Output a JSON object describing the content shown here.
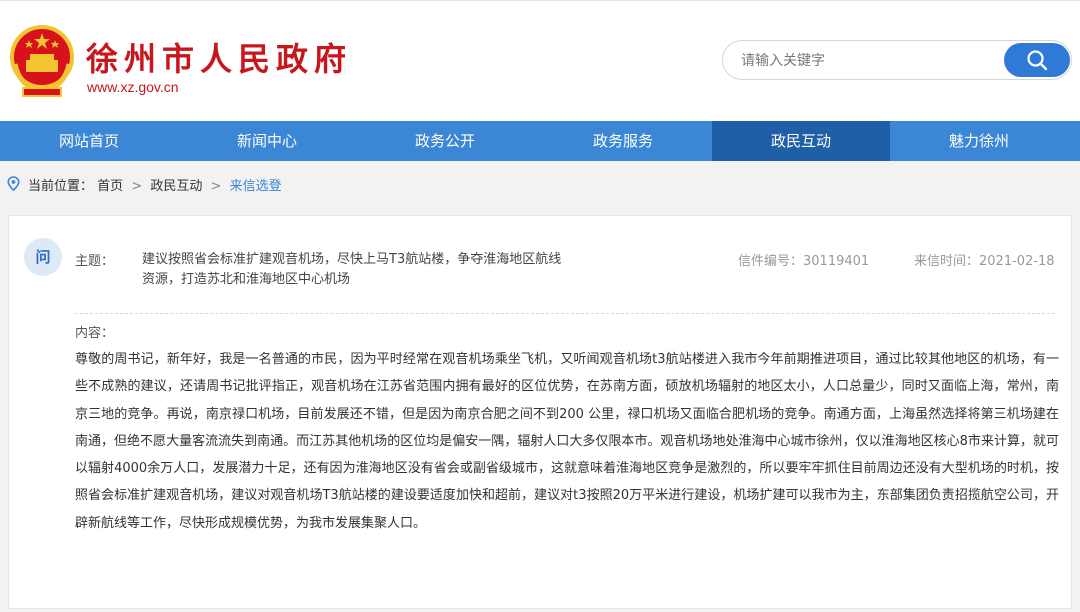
{
  "header": {
    "site_title": "徐州市人民政府",
    "site_url": "www.xz.gov.cn",
    "emblem_icon": "national-emblem-icon",
    "search_placeholder": "请输入关键字",
    "search_icon": "search-icon"
  },
  "nav": {
    "items": [
      {
        "label": "网站首页"
      },
      {
        "label": "新闻中心"
      },
      {
        "label": "政务公开"
      },
      {
        "label": "政务服务"
      },
      {
        "label": "政民互动",
        "active": true
      },
      {
        "label": "魅力徐州"
      }
    ]
  },
  "breadcrumb": {
    "prefix": "当前位置：",
    "items": [
      "首页",
      "政民互动",
      "来信选登"
    ],
    "separator": ">"
  },
  "letter": {
    "badge": "问",
    "subject_label": "主题：",
    "subject": "建议按照省会标准扩建观音机场，尽快上马T3航站楼，争夺淮海地区航线资源，打造苏北和淮海地区中心机场",
    "number_label": "信件编号：30119401",
    "date_label": "来信时间：2021-02-18",
    "content_label": "内容：",
    "content": "尊敬的周书记，新年好，我是一名普通的市民，因为平时经常在观音机场乘坐飞机，又听闻观音机场t3航站楼进入我市今年前期推进项目，通过比较其他地区的机场，有一些不成熟的建议，还请周书记批评指正，观音机场在江苏省范围内拥有最好的区位优势，在苏南方面，硕放机场辐射的地区太小，人口总量少，同时又面临上海，常州，南京三地的竞争。再说，南京禄口机场，目前发展还不错，但是因为南京合肥之间不到200 公里，禄口机场又面临合肥机场的竞争。南通方面，上海虽然选择将第三机场建在南通，但绝不愿大量客流流失到南通。而江苏其他机场的区位均是偏安一隅，辐射人口大多仅限本市。观音机场地处淮海中心城市徐州，仅以淮海地区核心8市来计算，就可以辐射4000余万人口，发展潜力十足，还有因为淮海地区没有省会或副省级城市，这就意味着淮海地区竞争是激烈的，所以要牢牢抓住目前周边还没有大型机场的时机，按照省会标准扩建观音机场，建议对观音机场T3航站楼的建设要适度加快和超前，建议对t3按照20万平米进行建设，机场扩建可以我市为主，东部集团负责招揽航空公司，开辟新航线等工作，尽快形成规模优势，为我市发展集聚人口。"
  },
  "colors": {
    "brand_red": "#c8161d",
    "nav_blue": "#3b86d5",
    "nav_active": "#1f5fa8",
    "accent_blue": "#2e7ad6"
  }
}
